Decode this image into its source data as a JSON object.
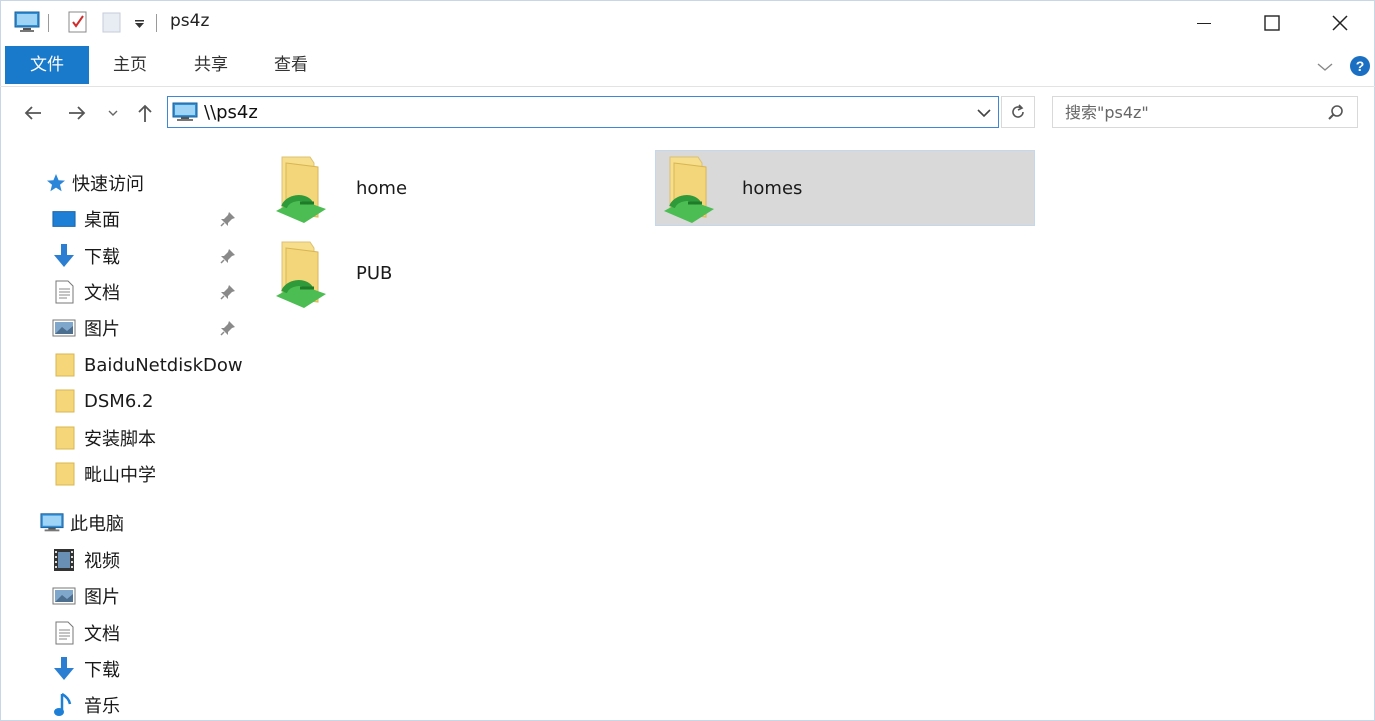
{
  "window": {
    "title": "ps4z"
  },
  "ribbon": {
    "tabs": [
      "文件",
      "主页",
      "共享",
      "查看"
    ]
  },
  "address": {
    "path": "\\\\ps4z"
  },
  "search": {
    "placeholder": "搜索\"ps4z\""
  },
  "sidebar": {
    "quick_access": {
      "label": "快速访问",
      "items": [
        {
          "label": "桌面",
          "icon": "desktop-icon",
          "pinned": true
        },
        {
          "label": "下载",
          "icon": "download-icon",
          "pinned": true
        },
        {
          "label": "文档",
          "icon": "document-icon",
          "pinned": true
        },
        {
          "label": "图片",
          "icon": "picture-icon",
          "pinned": true
        },
        {
          "label": "BaiduNetdiskDow",
          "icon": "folder-icon",
          "pinned": false
        },
        {
          "label": "DSM6.2",
          "icon": "folder-icon",
          "pinned": false
        },
        {
          "label": "安装脚本",
          "icon": "folder-icon",
          "pinned": false
        },
        {
          "label": "毗山中学",
          "icon": "folder-icon",
          "pinned": false
        }
      ]
    },
    "this_pc": {
      "label": "此电脑",
      "items": [
        {
          "label": "视频",
          "icon": "video-icon"
        },
        {
          "label": "图片",
          "icon": "picture-icon"
        },
        {
          "label": "文档",
          "icon": "document-icon"
        },
        {
          "label": "下载",
          "icon": "download-icon"
        },
        {
          "label": "音乐",
          "icon": "music-icon"
        }
      ]
    }
  },
  "content": {
    "items": [
      {
        "name": "home",
        "icon": "shared-folder-icon",
        "selected": false
      },
      {
        "name": "homes",
        "icon": "shared-folder-icon",
        "selected": true
      },
      {
        "name": "PUB",
        "icon": "shared-folder-icon",
        "selected": false
      }
    ]
  },
  "colors": {
    "accent": "#1979ca",
    "selection": "#d9d9d9",
    "folder": "#f5d77a"
  }
}
